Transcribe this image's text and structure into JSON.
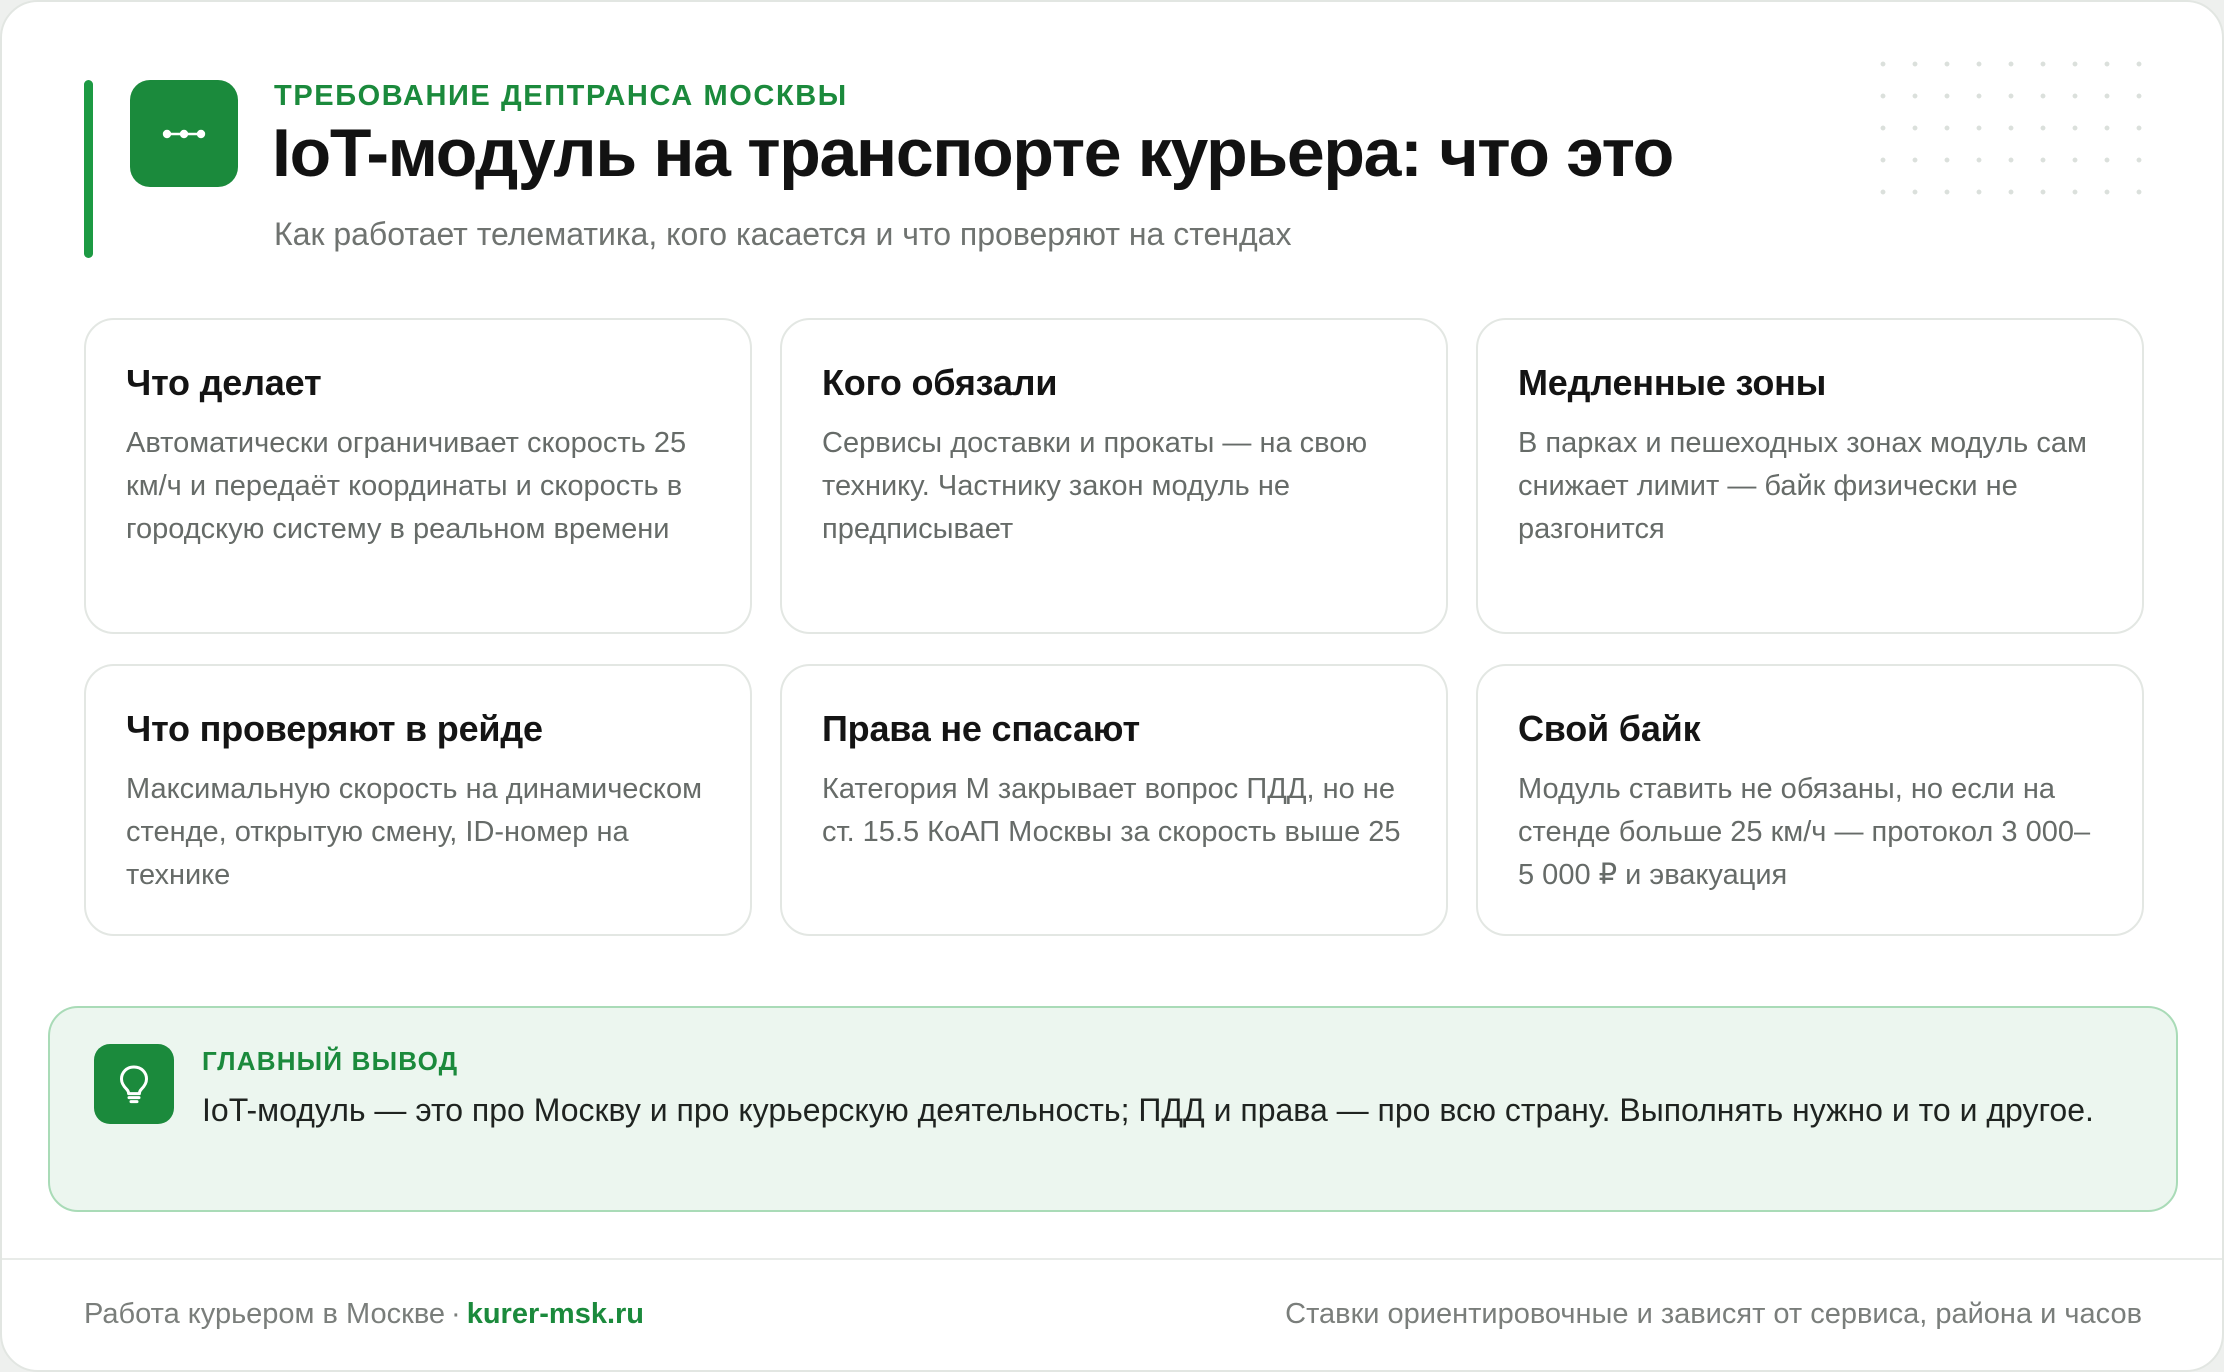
{
  "header": {
    "eyebrow": "ТРЕБОВАНИЕ ДЕПТРАНСА МОСКВЫ",
    "title": "IoT-модуль на транспорте курьера: что это",
    "subtitle": "Как работает телематика, кого касается и что проверяют на стендах",
    "logo_icon": "connection-nodes-icon"
  },
  "cards": [
    {
      "title": "Что делает",
      "text": "Автоматически ограничивает скорость 25 км/ч и передаёт координаты и скорость в городскую систему в реальном времени"
    },
    {
      "title": "Кого обязали",
      "text": "Сервисы доставки и прокаты — на свою технику. Частнику закон модуль не предписывает"
    },
    {
      "title": "Медленные зоны",
      "text": "В парках и пешеходных зонах модуль сам снижает лимит — байк физически не разгонится"
    },
    {
      "title": "Что проверяют в рейде",
      "text": "Максимальную скорость на динамическом стенде, открытую смену, ID-номер на технике"
    },
    {
      "title": "Права не спасают",
      "text": "Категория M закрывает вопрос ПДД, но не ст. 15.5 КоАП Москвы за скорость выше 25"
    },
    {
      "title": "Свой байк",
      "text": "Модуль ставить не обязаны, но если на стенде больше 25 км/ч — протокол 3 000–5 000 ₽ и эвакуация"
    }
  ],
  "conclusion": {
    "label": "ГЛАВНЫЙ ВЫВОД",
    "text": "IoT-модуль — это про Москву и про курьерскую деятельность; ПДД и права — про всю страну. Выполнять нужно и то и другое.",
    "icon": "lightbulb-icon"
  },
  "footer": {
    "left_text": "Работа курьером в Москве",
    "separator": "·",
    "site": "kurer-msk.ru",
    "right_text": "Ставки ориентировочные и зависят от сервиса, района и часов"
  },
  "colors": {
    "accent": "#1b8a3c",
    "accent_bar": "#1d9a43",
    "conclusion_bg": "#ecf6ef",
    "conclusion_border": "#a9dbb7"
  }
}
